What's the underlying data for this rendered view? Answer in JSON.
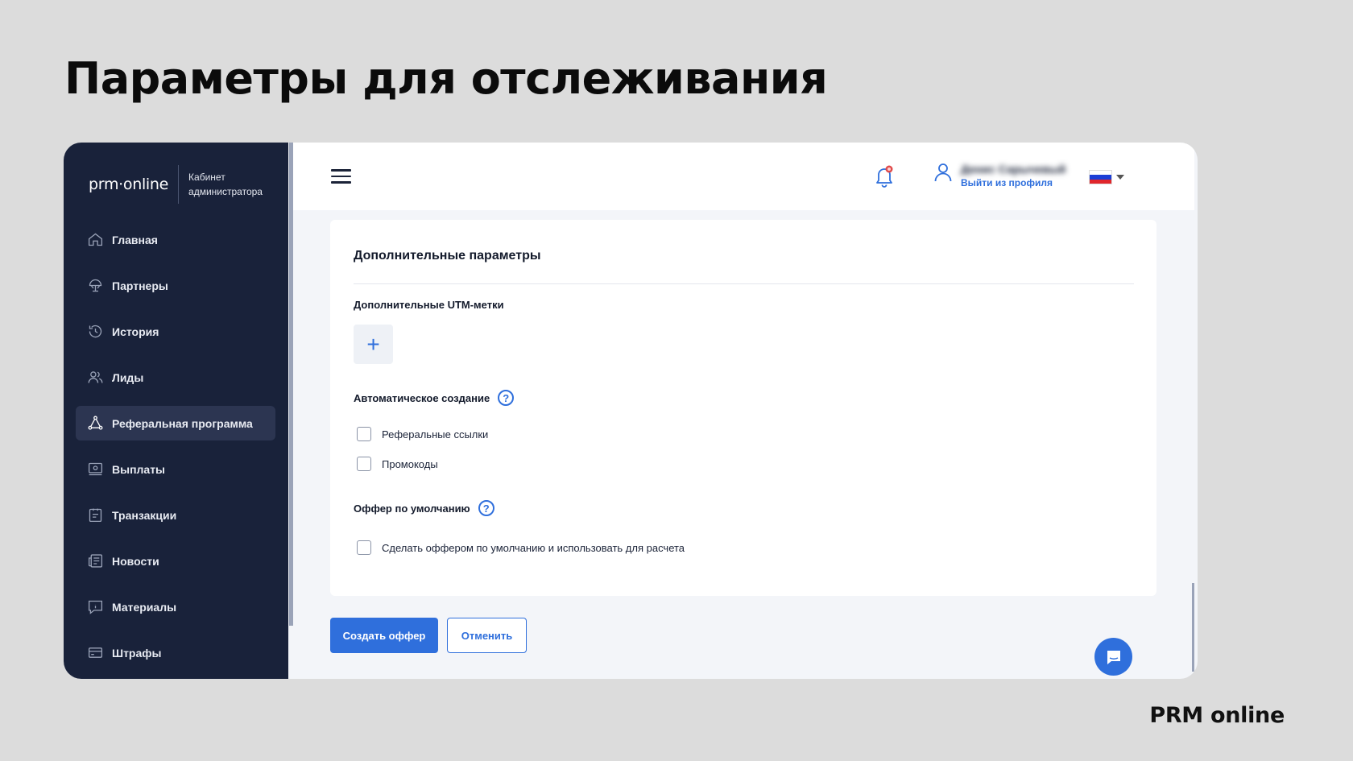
{
  "slide": {
    "title": "Параметры для отслеживания",
    "footer_brand": "PRM online"
  },
  "sidebar": {
    "logo": "prm·online",
    "logo_sub": "Кабинет администратора",
    "items": [
      {
        "label": "Главная",
        "icon": "home-icon",
        "active": false
      },
      {
        "label": "Партнеры",
        "icon": "partners-icon",
        "active": false
      },
      {
        "label": "История",
        "icon": "history-icon",
        "active": false
      },
      {
        "label": "Лиды",
        "icon": "users-icon",
        "active": false
      },
      {
        "label": "Реферальная программа",
        "icon": "referral-icon",
        "active": true
      },
      {
        "label": "Выплаты",
        "icon": "payouts-icon",
        "active": false
      },
      {
        "label": "Транзакции",
        "icon": "transactions-icon",
        "active": false
      },
      {
        "label": "Новости",
        "icon": "news-icon",
        "active": false
      },
      {
        "label": "Материалы",
        "icon": "materials-icon",
        "active": false
      },
      {
        "label": "Штрафы",
        "icon": "fines-icon",
        "active": false
      }
    ]
  },
  "topbar": {
    "user_name": "Денис Сарычевый",
    "logout_label": "Выйти из профиля",
    "language": "ru"
  },
  "card": {
    "title": "Дополнительные параметры",
    "utm_label": "Дополнительные UTM-метки",
    "utm_add_symbol": "+",
    "auto_label": "Автоматическое создание",
    "auto_options": [
      "Реферальные ссылки",
      "Промокоды"
    ],
    "default_offer_label": "Оффер по умолчанию",
    "default_offer_option": "Сделать оффером по умолчанию и использовать для расчета",
    "help_symbol": "?"
  },
  "actions": {
    "create_label": "Создать оффер",
    "cancel_label": "Отменить"
  },
  "colors": {
    "sidebar_bg": "#19223a",
    "accent": "#2f6fdc",
    "page_bg": "#dcdcdc"
  }
}
